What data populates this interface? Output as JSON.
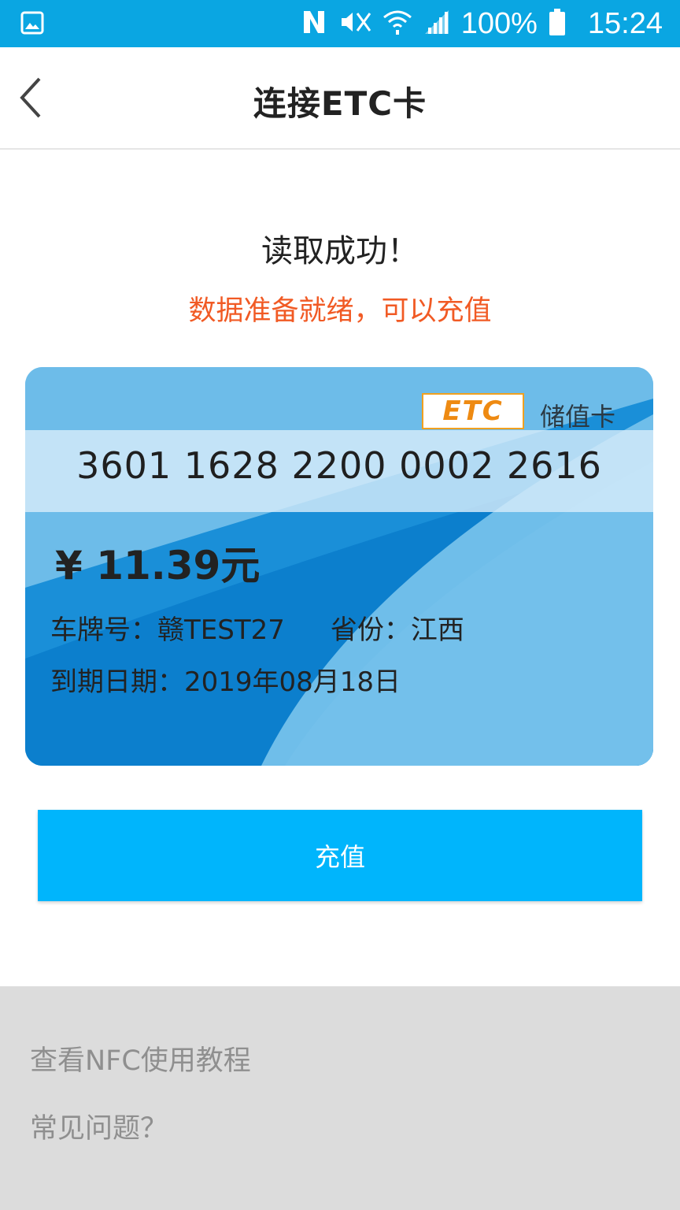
{
  "status_bar": {
    "battery": "100%",
    "time": "15:24",
    "icons": [
      "gallery-icon",
      "nfc-icon",
      "mute-icon",
      "wifi-icon",
      "signal-icon",
      "battery-icon"
    ]
  },
  "nav": {
    "title": "连接ETC卡",
    "back_icon": "chevron-left-icon"
  },
  "status": {
    "title": "读取成功！",
    "subtitle": "数据准备就绪，可以充值",
    "subtitle_color": "#f15a24"
  },
  "card": {
    "logo_text": "ETC",
    "type_label": "储值卡",
    "number": "3601 1628 2200 0002 2616",
    "balance": "¥ 11.39元",
    "plate_label": "车牌号：",
    "plate_value": "赣TEST27",
    "province_label": "省份：",
    "province_value": "江西",
    "expiry_label": "到期日期：",
    "expiry_value": "2019年08月18日"
  },
  "button": {
    "recharge": "充值",
    "color": "#00b5fc"
  },
  "footer": {
    "tutorial_link": "查看NFC使用教程",
    "faq_link": "常见问题？"
  }
}
